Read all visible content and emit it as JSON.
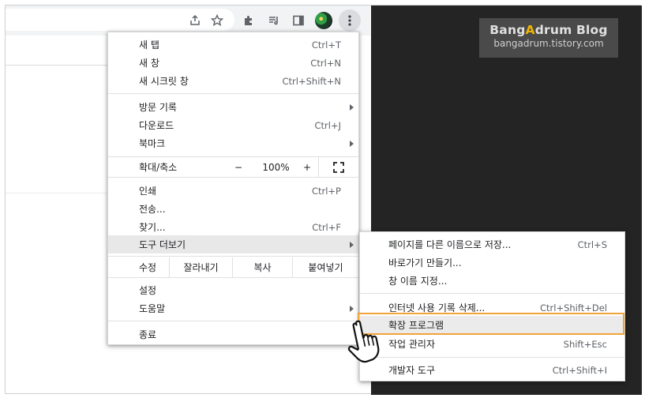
{
  "toolbar": {
    "icons": [
      "share-icon",
      "star-icon",
      "extensions-icon",
      "reading-list-icon",
      "side-panel-icon",
      "avatar",
      "menu-icon"
    ]
  },
  "watermark": {
    "title_pre": "Bang",
    "title_accent": "A",
    "title_post": "drum Blog",
    "url": "bangadrum.tistory.com",
    "accent_color": "#f0b400"
  },
  "menu": {
    "new_tab": {
      "label": "새 탭",
      "shortcut": "Ctrl+T"
    },
    "new_window": {
      "label": "새 창",
      "shortcut": "Ctrl+N"
    },
    "new_incognito": {
      "label": "새 시크릿 창",
      "shortcut": "Ctrl+Shift+N"
    },
    "history": {
      "label": "방문 기록"
    },
    "downloads": {
      "label": "다운로드",
      "shortcut": "Ctrl+J"
    },
    "bookmarks": {
      "label": "북마크"
    },
    "zoom": {
      "label": "확대/축소",
      "minus": "−",
      "value": "100%",
      "plus": "+"
    },
    "print": {
      "label": "인쇄",
      "shortcut": "Ctrl+P"
    },
    "cast": {
      "label": "전송..."
    },
    "find": {
      "label": "찾기...",
      "shortcut": "Ctrl+F"
    },
    "more_tools": {
      "label": "도구 더보기"
    },
    "edit": {
      "label": "수정",
      "cut": "잘라내기",
      "copy": "복사",
      "paste": "붙여넣기"
    },
    "settings": {
      "label": "설정"
    },
    "help": {
      "label": "도움말"
    },
    "exit": {
      "label": "종료"
    }
  },
  "submenu": {
    "save_page": {
      "label": "페이지를 다른 이름으로 저장...",
      "shortcut": "Ctrl+S"
    },
    "create_shortcut": {
      "label": "바로가기 만들기..."
    },
    "name_window": {
      "label": "창 이름 지정..."
    },
    "clear_data": {
      "label": "인터넷 사용 기록 삭제...",
      "shortcut": "Ctrl+Shift+Del"
    },
    "extensions": {
      "label": "확장 프로그램"
    },
    "task_manager": {
      "label": "작업 관리자",
      "shortcut": "Shift+Esc"
    },
    "devtools": {
      "label": "개발자 도구",
      "shortcut": "Ctrl+Shift+I"
    }
  },
  "colors": {
    "highlight": "#f0a43a",
    "dark_pane": "#242424"
  }
}
